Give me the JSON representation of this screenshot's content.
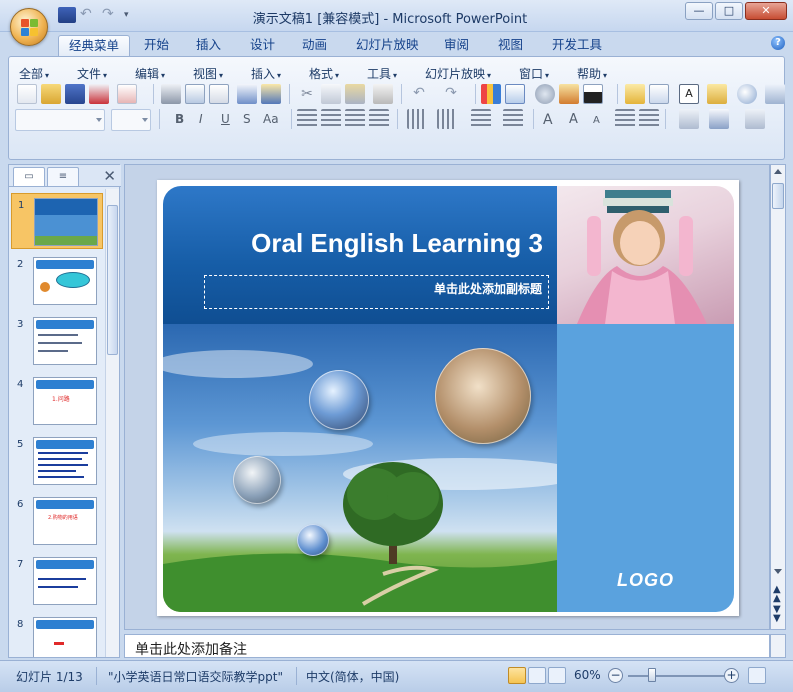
{
  "window": {
    "title": "演示文稿1 [兼容模式] - Microsoft PowerPoint",
    "minimize": "—",
    "maximize": "□",
    "close": "✕"
  },
  "ribbon_tabs": [
    "经典菜单",
    "开始",
    "插入",
    "设计",
    "动画",
    "幻灯片放映",
    "审阅",
    "视图",
    "开发工具"
  ],
  "menu": [
    "全部",
    "文件",
    "编辑",
    "视图",
    "插入",
    "格式",
    "工具",
    "幻灯片放映",
    "窗口",
    "帮助"
  ],
  "format_buttons": [
    "B",
    "I",
    "U",
    "S",
    "Aa"
  ],
  "font_size_text": "A",
  "slide": {
    "title": "Oral English Learning 3",
    "subtitle_placeholder": "单击此处添加副标题",
    "logo": "LOGO"
  },
  "thumbnails": [
    {
      "num": "1",
      "red": ""
    },
    {
      "num": "2",
      "red": ""
    },
    {
      "num": "3",
      "red": ""
    },
    {
      "num": "4",
      "red": "1.问路"
    },
    {
      "num": "5",
      "red": ""
    },
    {
      "num": "6",
      "red": "2.购物的用语"
    },
    {
      "num": "7",
      "red": ""
    },
    {
      "num": "8",
      "red": ""
    }
  ],
  "notes_placeholder": "单击此处添加备注",
  "status": {
    "slide_count": "幻灯片 1/13",
    "theme": "\"小学英语日常口语交际教学ppt\"",
    "language": "中文(简体，中国)",
    "zoom": "60%"
  },
  "colors": {
    "title_band": "#175ea8",
    "logo_panel": "#5aa2de",
    "selected_thumb": "#f7c565"
  }
}
